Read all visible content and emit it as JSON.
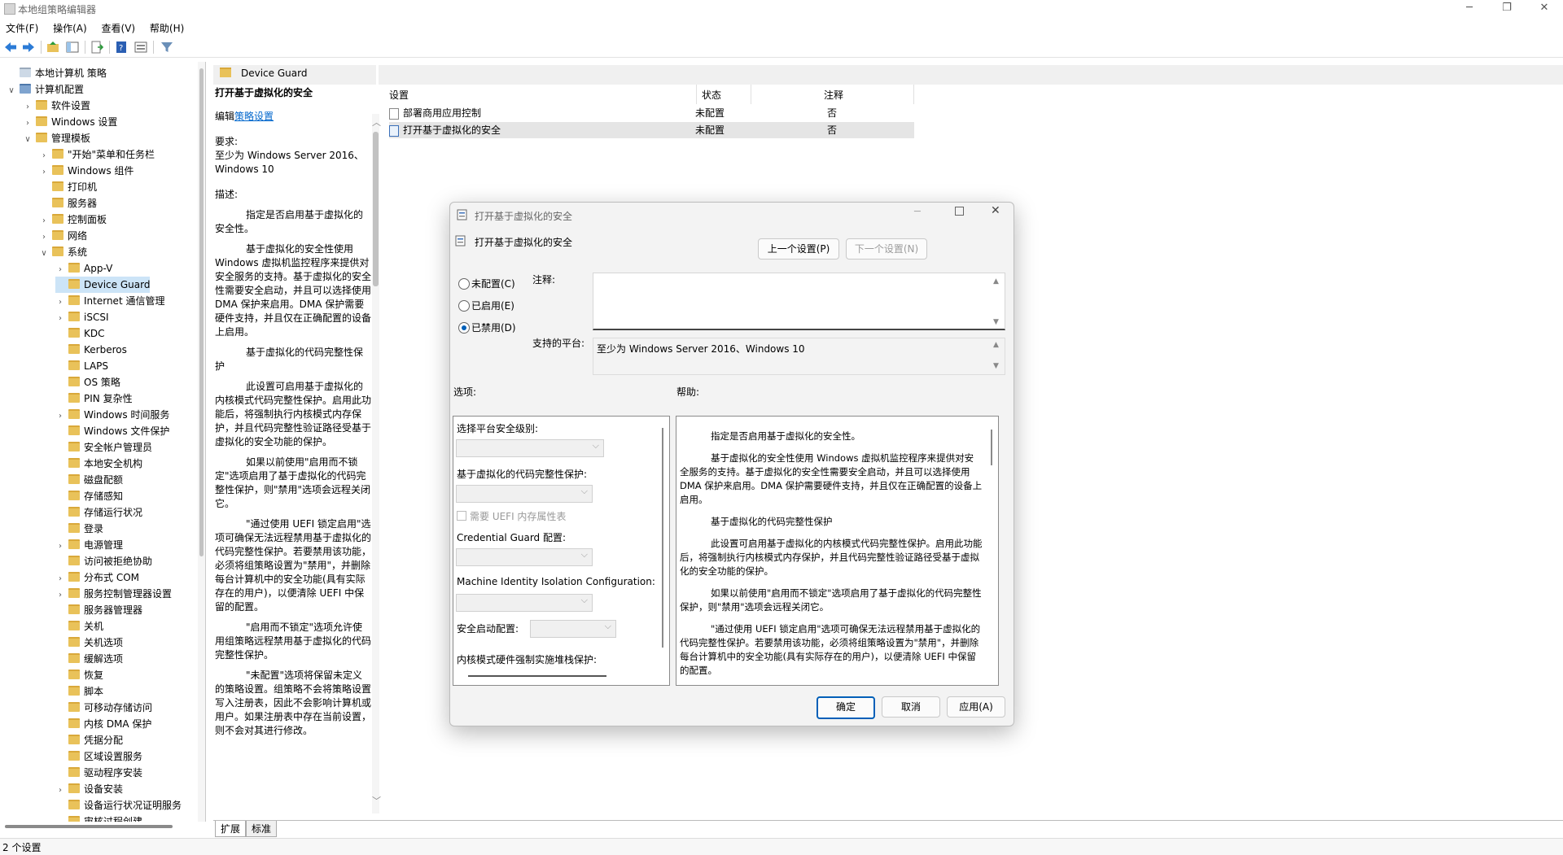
{
  "window": {
    "title": "本地组策略编辑器",
    "minimize": "─",
    "maximize": "❐",
    "close": "✕"
  },
  "menu": [
    "文件(F)",
    "操作(A)",
    "查看(V)",
    "帮助(H)"
  ],
  "tree": [
    {
      "label": "本地计算机 策略",
      "level": 0,
      "chev": ""
    },
    {
      "label": "计算机配置",
      "level": 0,
      "chev": "∨"
    },
    {
      "label": "软件设置",
      "level": 1,
      "chev": "›"
    },
    {
      "label": "Windows 设置",
      "level": 1,
      "chev": "›"
    },
    {
      "label": "管理模板",
      "level": 1,
      "chev": "∨"
    },
    {
      "label": "\"开始\"菜单和任务栏",
      "level": 2,
      "chev": "›"
    },
    {
      "label": "Windows 组件",
      "level": 2,
      "chev": "›"
    },
    {
      "label": "打印机",
      "level": 2,
      "chev": ""
    },
    {
      "label": "服务器",
      "level": 2,
      "chev": ""
    },
    {
      "label": "控制面板",
      "level": 2,
      "chev": "›"
    },
    {
      "label": "网络",
      "level": 2,
      "chev": "›"
    },
    {
      "label": "系统",
      "level": 2,
      "chev": "∨"
    },
    {
      "label": "App-V",
      "level": 3,
      "chev": "›"
    },
    {
      "label": "Device Guard",
      "level": 3,
      "chev": "",
      "selected": true
    },
    {
      "label": "Internet 通信管理",
      "level": 3,
      "chev": "›"
    },
    {
      "label": "iSCSI",
      "level": 3,
      "chev": "›"
    },
    {
      "label": "KDC",
      "level": 3,
      "chev": ""
    },
    {
      "label": "Kerberos",
      "level": 3,
      "chev": ""
    },
    {
      "label": "LAPS",
      "level": 3,
      "chev": ""
    },
    {
      "label": "OS 策略",
      "level": 3,
      "chev": ""
    },
    {
      "label": "PIN 复杂性",
      "level": 3,
      "chev": ""
    },
    {
      "label": "Windows 时间服务",
      "level": 3,
      "chev": "›"
    },
    {
      "label": "Windows 文件保护",
      "level": 3,
      "chev": ""
    },
    {
      "label": "安全帐户管理员",
      "level": 3,
      "chev": ""
    },
    {
      "label": "本地安全机构",
      "level": 3,
      "chev": ""
    },
    {
      "label": "磁盘配额",
      "level": 3,
      "chev": ""
    },
    {
      "label": "存储感知",
      "level": 3,
      "chev": ""
    },
    {
      "label": "存储运行状况",
      "level": 3,
      "chev": ""
    },
    {
      "label": "登录",
      "level": 3,
      "chev": ""
    },
    {
      "label": "电源管理",
      "level": 3,
      "chev": "›"
    },
    {
      "label": "访问被拒绝协助",
      "level": 3,
      "chev": ""
    },
    {
      "label": "分布式 COM",
      "level": 3,
      "chev": "›"
    },
    {
      "label": "服务控制管理器设置",
      "level": 3,
      "chev": "›"
    },
    {
      "label": "服务器管理器",
      "level": 3,
      "chev": ""
    },
    {
      "label": "关机",
      "level": 3,
      "chev": ""
    },
    {
      "label": "关机选项",
      "level": 3,
      "chev": ""
    },
    {
      "label": "缓解选项",
      "level": 3,
      "chev": ""
    },
    {
      "label": "恢复",
      "level": 3,
      "chev": ""
    },
    {
      "label": "脚本",
      "level": 3,
      "chev": ""
    },
    {
      "label": "可移动存储访问",
      "level": 3,
      "chev": ""
    },
    {
      "label": "内核 DMA 保护",
      "level": 3,
      "chev": ""
    },
    {
      "label": "凭据分配",
      "level": 3,
      "chev": ""
    },
    {
      "label": "区域设置服务",
      "level": 3,
      "chev": ""
    },
    {
      "label": "驱动程序安装",
      "level": 3,
      "chev": ""
    },
    {
      "label": "设备安装",
      "level": 3,
      "chev": "›"
    },
    {
      "label": "设备运行状况证明服务",
      "level": 3,
      "chev": ""
    },
    {
      "label": "审核过程创建",
      "level": 3,
      "chev": ""
    }
  ],
  "folder_header": "Device Guard",
  "desc": {
    "title": "打开基于虚拟化的安全",
    "edit_prefix": "编辑",
    "edit_link": "策略设置",
    "req_label": "要求:",
    "req_text": "至少为 Windows Server 2016、Windows 10",
    "desc_label": "描述:",
    "p1": "指定是否启用基于虚拟化的安全性。",
    "p2": "基于虚拟化的安全性使用 Windows 虚拟机监控程序来提供对安全服务的支持。基于虚拟化的安全性需要安全启动，并且可以选择使用 DMA 保护来启用。DMA 保护需要硬件支持，并且仅在正确配置的设备上启用。",
    "p3": "基于虚拟化的代码完整性保护",
    "p4": "此设置可启用基于虚拟化的内核模式代码完整性保护。启用此功能后，将强制执行内核模式内存保护，并且代码完整性验证路径受基于虚拟化的安全功能的保护。",
    "p5": "如果以前使用\"启用而不锁定\"选项启用了基于虚拟化的代码完整性保护，则\"禁用\"选项会远程关闭它。",
    "p6": "\"通过使用 UEFI 锁定启用\"选项可确保无法远程禁用基于虚拟化的代码完整性保护。若要禁用该功能，必须将组策略设置为\"禁用\"，并删除每台计算机中的安全功能(具有实际存在的用户)，以便清除 UEFI 中保留的配置。",
    "p7": "\"启用而不锁定\"选项允许使用组策略远程禁用基于虚拟化的代码完整性保护。",
    "p8": "\"未配置\"选项将保留未定义的策略设置。组策略不会将策略设置写入注册表，因此不会影响计算机或用户。如果注册表中存在当前设置，则不会对其进行修改。"
  },
  "list": {
    "col_setting": "设置",
    "col_state": "状态",
    "col_comment": "注释",
    "rows": [
      {
        "name": "部署商用应用控制",
        "state": "未配置",
        "comment": "否"
      },
      {
        "name": "打开基于虚拟化的安全",
        "state": "未配置",
        "comment": "否"
      }
    ]
  },
  "tabs": [
    "扩展",
    "标准"
  ],
  "status": "2 个设置",
  "dialog": {
    "title": "打开基于虚拟化的安全",
    "setting_name": "打开基于虚拟化的安全",
    "prev": "上一个设置(P)",
    "next": "下一个设置(N)",
    "radio_not_configured": "未配置(C)",
    "radio_enabled": "已启用(E)",
    "radio_disabled": "已禁用(D)",
    "selected_radio": "disabled",
    "comment_label": "注释:",
    "platform_label": "支持的平台:",
    "platform_value": "至少为 Windows Server 2016、Windows 10",
    "options_label": "选项:",
    "help_label": "帮助:",
    "options": {
      "platform_level": "选择平台安全级别:",
      "code_integrity": "基于虚拟化的代码完整性保护:",
      "uefi_mat": "需要 UEFI 内存属性表",
      "credential_guard": "Credential Guard 配置:",
      "machine_identity": "Machine Identity Isolation Configuration:",
      "secure_launch": "安全启动配置:",
      "kernel_stack": "内核模式硬件强制实施堆栈保护:"
    },
    "help": {
      "h1": "指定是否启用基于虚拟化的安全性。",
      "h2": "基于虚拟化的安全性使用 Windows 虚拟机监控程序来提供对安全服务的支持。基于虚拟化的安全性需要安全启动，并且可以选择使用 DMA 保护来启用。DMA 保护需要硬件支持，并且仅在正确配置的设备上启用。",
      "h3": "基于虚拟化的代码完整性保护",
      "h4": "此设置可启用基于虚拟化的内核模式代码完整性保护。启用此功能后，将强制执行内核模式内存保护，并且代码完整性验证路径受基于虚拟化的安全功能的保护。",
      "h5": "如果以前使用\"启用而不锁定\"选项启用了基于虚拟化的代码完整性保护，则\"禁用\"选项会远程关闭它。",
      "h6": "\"通过使用 UEFI 锁定启用\"选项可确保无法远程禁用基于虚拟化的代码完整性保护。若要禁用该功能，必须将组策略设置为\"禁用\"，并删除每台计算机中的安全功能(具有实际存在的用户)，以便清除 UEFI 中保留的配置。"
    },
    "ok": "确定",
    "cancel": "取消",
    "apply": "应用(A)"
  },
  "colors": {
    "accent": "#005fb8",
    "selection": "#cce4f7",
    "folder": "#e9c25a",
    "link": "#0066cc"
  }
}
